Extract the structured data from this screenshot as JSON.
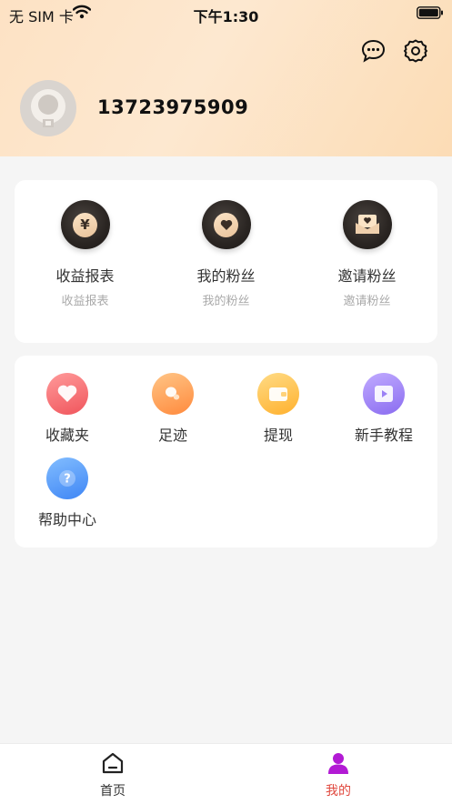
{
  "status_bar": {
    "carrier": "无 SIM 卡",
    "time": "下午1:30"
  },
  "profile": {
    "phone": "13723975909"
  },
  "stats": [
    {
      "title": "收益报表",
      "subtitle": "收益报表",
      "icon": "yuan-icon"
    },
    {
      "title": "我的粉丝",
      "subtitle": "我的粉丝",
      "icon": "heart-icon"
    },
    {
      "title": "邀请粉丝",
      "subtitle": "邀请粉丝",
      "icon": "heart-box-icon"
    }
  ],
  "tools": [
    {
      "label": "收藏夹",
      "icon": "heart-icon",
      "color_from": "#ff8b8b",
      "color_to": "#f0555c"
    },
    {
      "label": "足迹",
      "icon": "footprint-icon",
      "color_from": "#ffc07a",
      "color_to": "#ff8a3d"
    },
    {
      "label": "提现",
      "icon": "wallet-icon",
      "color_from": "#ffd675",
      "color_to": "#ffb12e"
    },
    {
      "label": "新手教程",
      "icon": "video-icon",
      "color_from": "#b39cff",
      "color_to": "#8a6cf0"
    },
    {
      "label": "帮助中心",
      "icon": "help-icon",
      "color_from": "#74b6ff",
      "color_to": "#3f86f5"
    }
  ],
  "tabbar": {
    "home_label": "首页",
    "mine_label": "我的",
    "active_color": "#e0483e",
    "active_icon_color": "#b21ad4"
  }
}
